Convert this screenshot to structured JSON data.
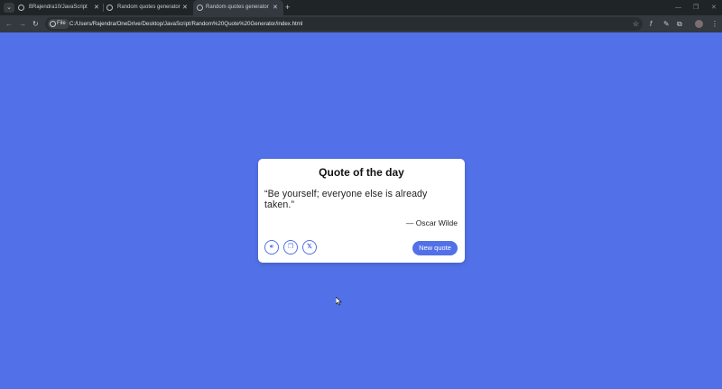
{
  "browser": {
    "tabs": [
      {
        "label": "BRajendra10/JavaScript"
      },
      {
        "label": "Random quotes generator"
      },
      {
        "label": "Random quotes generator"
      }
    ],
    "file_chip": "File",
    "url": "C:/Users/Rajendra/OneDrive/Desktop/JavaScript/Random%20Quote%20Generator/index.html"
  },
  "card": {
    "title": "Quote of the day",
    "quote": "“Be yourself; everyone else is already taken.”",
    "author": "— Oscar Wilde",
    "new_quote_label": "New quote"
  },
  "colors": {
    "background": "#5271e8",
    "accent": "#5271e8",
    "card": "#ffffff"
  },
  "icons": {
    "speak": "speaker-icon",
    "copy": "copy-icon",
    "share": "x-logo-icon"
  }
}
